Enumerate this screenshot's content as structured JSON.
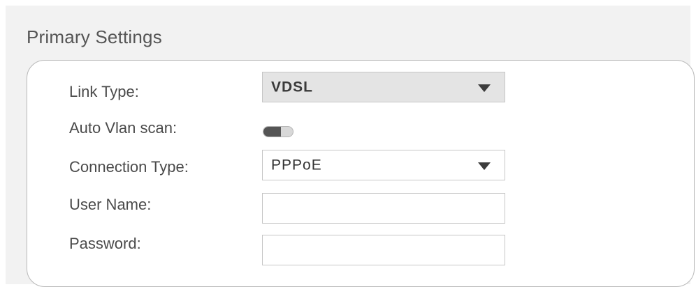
{
  "section": {
    "title": "Primary Settings"
  },
  "link_type": {
    "label": "Link Type:",
    "value": "VDSL",
    "disabled": true,
    "icon": "chevron-down-icon"
  },
  "auto_vlan_scan": {
    "label": "Auto Vlan scan:",
    "state": "off"
  },
  "connection_type": {
    "label": "Connection Type:",
    "value": "PPPoE",
    "icon": "chevron-down-icon"
  },
  "user_name": {
    "label": "User Name:",
    "value": "",
    "placeholder": ""
  },
  "password": {
    "label": "Password:",
    "value": "",
    "placeholder": ""
  },
  "colors": {
    "panel_background": "#f2f2f2",
    "disabled_field": "#e4e4e4",
    "card_border": "#b8b8b8",
    "toggle_knob": "#555555"
  }
}
